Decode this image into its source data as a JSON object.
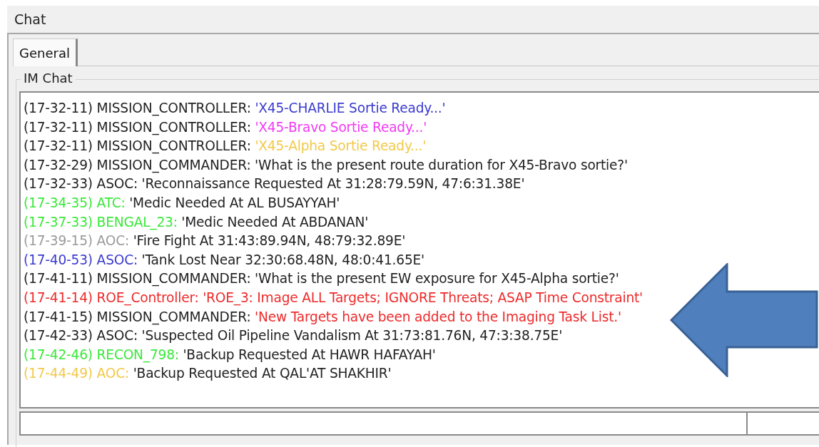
{
  "window": {
    "title": "Chat"
  },
  "tabs": [
    {
      "label": "General",
      "selected": true
    }
  ],
  "group": {
    "title": "IM Chat"
  },
  "messages": [
    {
      "head": {
        "text": "(17-32-11) MISSION_CONTROLLER:",
        "color": "#222222"
      },
      "body": {
        "text": "'X45-CHARLIE Sortie Ready...'",
        "color": "#3a3ad0"
      }
    },
    {
      "head": {
        "text": "(17-32-11) MISSION_CONTROLLER:",
        "color": "#222222"
      },
      "body": {
        "text": "'X45-Bravo Sortie Ready...'",
        "color": "#f23af2"
      }
    },
    {
      "head": {
        "text": "(17-32-11) MISSION_CONTROLLER:",
        "color": "#222222"
      },
      "body": {
        "text": "'X45-Alpha Sortie Ready...'",
        "color": "#f2c94a"
      }
    },
    {
      "head": {
        "text": "(17-32-29) MISSION_COMMANDER:",
        "color": "#222222"
      },
      "body": {
        "text": "'What is the present route duration for X45-Bravo sortie?'",
        "color": "#222222"
      }
    },
    {
      "head": {
        "text": "(17-32-33) ASOC:",
        "color": "#222222"
      },
      "body": {
        "text": "'Reconnaissance Requested At 31:28:79.59N, 47:6:31.38E'",
        "color": "#222222"
      }
    },
    {
      "head": {
        "text": "(17-34-35) ATC:",
        "color": "#3ae83a"
      },
      "body": {
        "text": "'Medic Needed At AL BUSAYYAH'",
        "color": "#222222"
      }
    },
    {
      "head": {
        "text": "(17-37-33) BENGAL_23:",
        "color": "#3ae83a"
      },
      "body": {
        "text": "'Medic Needed At ABDANAN'",
        "color": "#222222"
      }
    },
    {
      "head": {
        "text": "(17-39-15) AOC:",
        "color": "#9a9a9a"
      },
      "body": {
        "text": "'Fire Fight At 31:43:89.94N, 48:79:32.89E'",
        "color": "#222222"
      }
    },
    {
      "head": {
        "text": "(17-40-53) ASOC:",
        "color": "#3a3ad0"
      },
      "body": {
        "text": "'Tank Lost Near 32:30:68.48N, 48:0:41.65E'",
        "color": "#222222"
      }
    },
    {
      "head": {
        "text": "(17-41-11) MISSION_COMMANDER:",
        "color": "#222222"
      },
      "body": {
        "text": "'What is the present EW exposure for X45-Alpha sortie?'",
        "color": "#222222"
      }
    },
    {
      "head": {
        "text": "(17-41-14) ROE_Controller:",
        "color": "#ee2a2a"
      },
      "body": {
        "text": "'ROE_3: Image ALL Targets; IGNORE Threats; ASAP Time Constraint'",
        "color": "#ee2a2a"
      }
    },
    {
      "head": {
        "text": "(17-41-15) MISSION_COMMANDER:",
        "color": "#222222"
      },
      "body": {
        "text": "'New Targets have been added to the Imaging Task List.'",
        "color": "#ee2a2a"
      }
    },
    {
      "head": {
        "text": "(17-42-33) ASOC:",
        "color": "#222222"
      },
      "body": {
        "text": "'Suspected Oil Pipeline Vandalism At 31:73:81.76N, 47:3:38.75E'",
        "color": "#222222"
      }
    },
    {
      "head": {
        "text": "(17-42-46) RECON_798:",
        "color": "#3ae83a"
      },
      "body": {
        "text": "'Backup Requested At HAWR HAFAYAH'",
        "color": "#222222"
      }
    },
    {
      "head": {
        "text": "(17-44-49) AOC:",
        "color": "#f2c94a"
      },
      "body": {
        "text": "'Backup Requested At QAL'AT SHAKHIR'",
        "color": "#222222"
      }
    }
  ]
}
